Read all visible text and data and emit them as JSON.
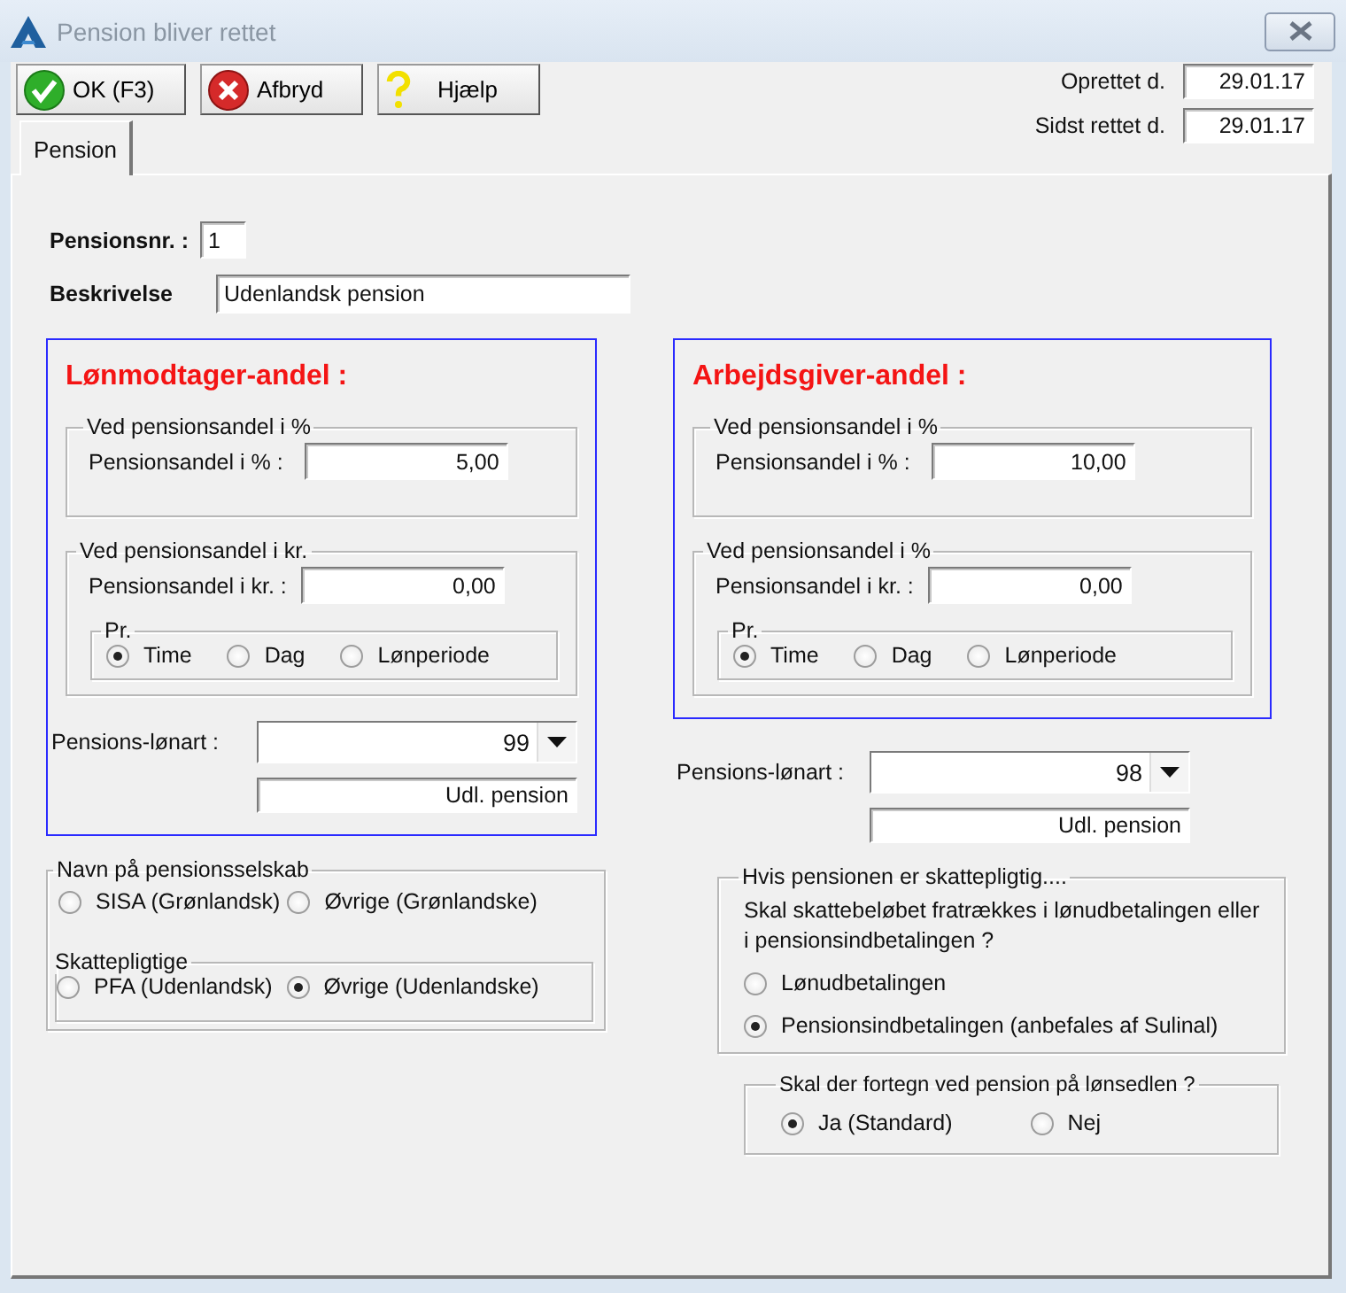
{
  "window": {
    "title": "Pension bliver rettet"
  },
  "toolbar": [
    {
      "kind": "ok",
      "label": "OK (F3)"
    },
    {
      "kind": "cancel",
      "label": "Afbryd"
    },
    {
      "kind": "help",
      "label": "Hjælp"
    }
  ],
  "dates": [
    {
      "label": "Oprettet d.",
      "value": "29.01.17"
    },
    {
      "label": "Sidst rettet d.",
      "value": "29.01.17"
    }
  ],
  "tabs": [
    {
      "label": "Pension",
      "selected": true
    }
  ],
  "pension_nr": {
    "label": "Pensionsnr. :",
    "value": "1"
  },
  "description": {
    "label": "Beskrivelse",
    "value": "Udenlandsk pension"
  },
  "shares": [
    {
      "title": "Lønmodtager-andel :",
      "percent_group": {
        "title": "Ved pensionsandel i %",
        "label": "Pensionsandel i % :",
        "value": "5,00"
      },
      "amount_group": {
        "title": "Ved pensionsandel i kr.",
        "label": "Pensionsandel i kr. :",
        "value": "0,00",
        "per": {
          "title": "Pr.",
          "options": [
            {
              "label": "Time",
              "selected": true
            },
            {
              "label": "Dag",
              "selected": false
            },
            {
              "label": "Lønperiode",
              "selected": false
            }
          ]
        }
      },
      "wage_type": {
        "label": "Pensions-lønart :",
        "value": "99",
        "description": "Udl. pension"
      }
    },
    {
      "title": "Arbejdsgiver-andel :",
      "percent_group": {
        "title": "Ved pensionsandel i %",
        "label": "Pensionsandel i % :",
        "value": "10,00"
      },
      "amount_group": {
        "title": "Ved pensionsandel i %",
        "label": "Pensionsandel i kr. :",
        "value": "0,00",
        "per": {
          "title": "Pr.",
          "options": [
            {
              "label": "Time",
              "selected": true
            },
            {
              "label": "Dag",
              "selected": false
            },
            {
              "label": "Lønperiode",
              "selected": false
            }
          ]
        }
      },
      "wage_type": {
        "label": "Pensions-lønart :",
        "value": "98",
        "description": "Udl. pension"
      }
    }
  ],
  "company": {
    "title": "Navn på pensionsselskab",
    "options": [
      {
        "label": "SISA (Grønlandsk)",
        "selected": false
      },
      {
        "label": "Øvrige (Grønlandske)",
        "selected": false
      }
    ],
    "taxable": {
      "title": "Skattepligtige",
      "options": [
        {
          "label": "PFA (Udenlandsk)",
          "selected": false
        },
        {
          "label": "Øvrige (Udenlandske)",
          "selected": true
        }
      ]
    }
  },
  "tax": {
    "title": "Hvis pensionen er skattepligtig....",
    "question": "Skal skattebeløbet fratrækkes i lønudbetalingen eller i pensionsindbetalingen ?",
    "options": [
      {
        "label": "Lønudbetalingen",
        "selected": false
      },
      {
        "label": "Pensionsindbetalingen (anbefales af Sulinal)",
        "selected": true
      }
    ]
  },
  "payslip": {
    "title": "Skal der fortegn ved pension på lønsedlen ?",
    "options": [
      {
        "label": "Ja (Standard)",
        "selected": true
      },
      {
        "label": "Nej",
        "selected": false
      }
    ]
  }
}
